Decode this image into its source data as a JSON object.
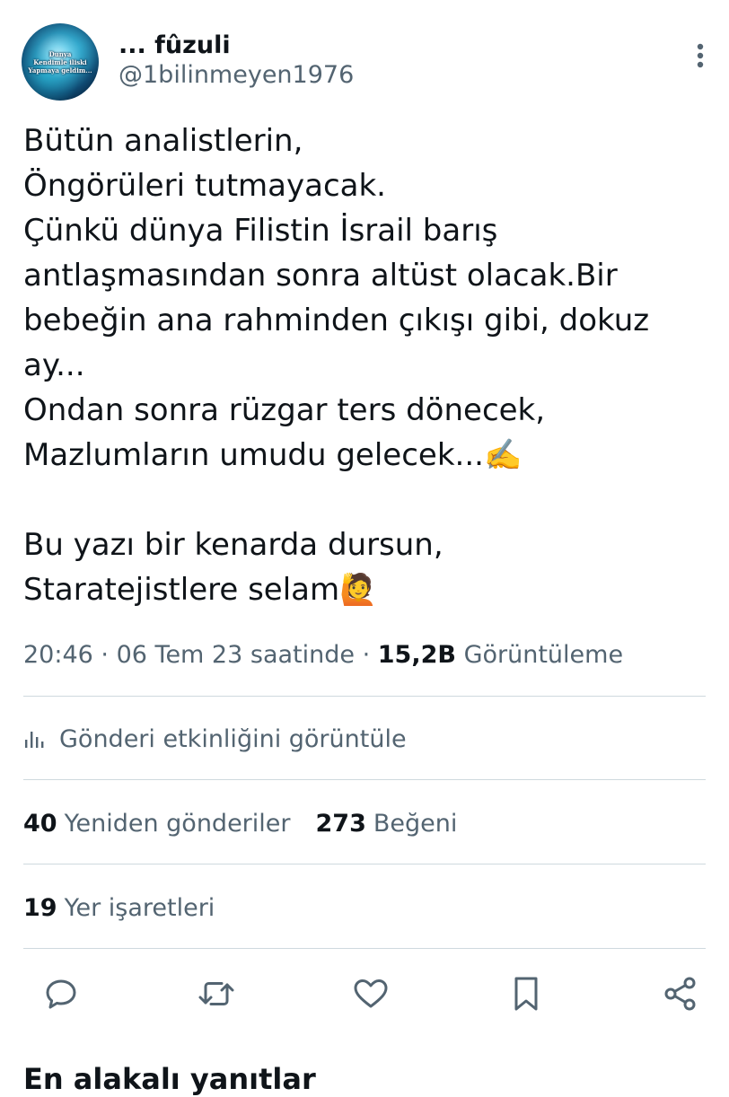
{
  "author": {
    "display_name": "... fûzuli",
    "handle": "@1bilinmeyen1976",
    "avatar_text": [
      "Dunya",
      "Kendimle iliski",
      "Yapmaya geldim..."
    ]
  },
  "tweet": {
    "text": "Bütün analistlerin,\nÖngörüleri tutmayacak.\nÇünkü dünya Filistin İsrail barış antlaşmasından sonra altüst olacak.Bir bebeğin ana rahminden çıkışı gibi, dokuz ay...\nOndan sonra rüzgar ters dönecek,\nMazlumların umudu gelecek...✍️\n\nBu yazı bir kenarda dursun,\nStaratejistlere selam🙋"
  },
  "meta": {
    "time": "20:46",
    "date": "06 Tem 23 saatinde",
    "separator": "·",
    "views_count": "15,2B",
    "views_label": "Görüntüleme"
  },
  "activity": {
    "label": "Gönderi etkinliğini görüntüle",
    "icon": "analytics-icon"
  },
  "stats": {
    "reposts_count": "40",
    "reposts_label": "Yeniden gönderiler",
    "likes_count": "273",
    "likes_label": "Beğeni",
    "bookmarks_count": "19",
    "bookmarks_label": "Yer işaretleri"
  },
  "actions": [
    "reply-icon",
    "repost-icon",
    "like-icon",
    "bookmark-icon",
    "share-icon"
  ],
  "more_icon": "more-vertical-icon",
  "partial_heading": "En alakalı yanıtlar",
  "colors": {
    "text": "#0f1419",
    "secondary": "#536471",
    "divider": "#cfd9de"
  }
}
